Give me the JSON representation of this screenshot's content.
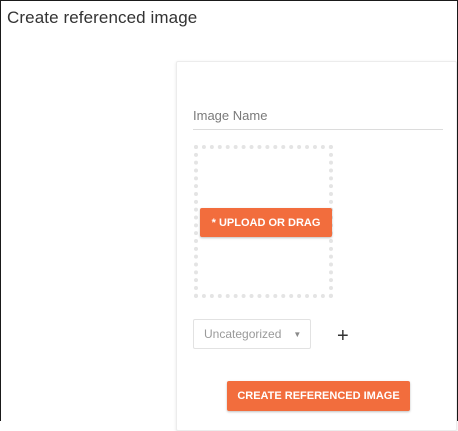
{
  "page": {
    "title": "Create referenced image"
  },
  "form": {
    "image_name_placeholder": "Image Name",
    "image_name_value": "",
    "upload_button_label": "* UPLOAD OR DRAG",
    "category_selected": "Uncategorized",
    "category_caret": "▼",
    "add_category_icon": "+",
    "submit_label": "CREATE REFERENCED IMAGE"
  },
  "colors": {
    "accent": "#f26d3d",
    "dropzone_border": "#e4e4e4"
  }
}
